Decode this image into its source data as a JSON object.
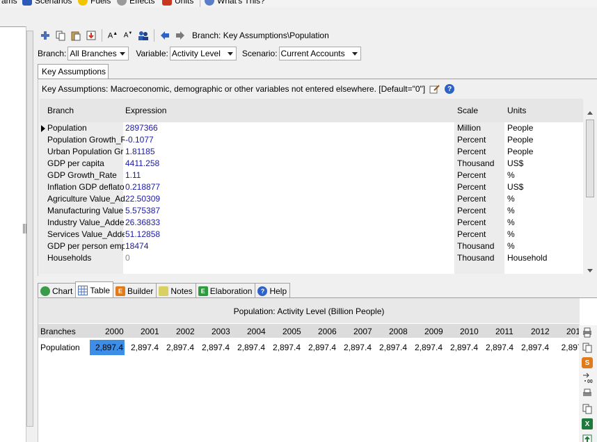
{
  "menu": {
    "items": [
      {
        "label": "rams",
        "icon": "diagrams-icon"
      },
      {
        "label": "Scenarios",
        "icon": "scenarios-icon"
      },
      {
        "label": "Fuels",
        "icon": "fuels-icon"
      },
      {
        "label": "Effects",
        "icon": "effects-icon"
      },
      {
        "label": "Units",
        "icon": "units-icon"
      },
      {
        "label": "What's This?",
        "icon": "whats-this-icon"
      }
    ]
  },
  "toolbar": {
    "path_text": "Branch: Key Assumptions\\Population"
  },
  "filters": {
    "branch_label": "Branch:",
    "branch_value": "All Branches",
    "variable_label": "Variable:",
    "variable_value": "Activity Level",
    "scenario_label": "Scenario:",
    "scenario_value": "Current Accounts"
  },
  "key_assumptions": {
    "tab_label": "Key Assumptions",
    "description": "Key Assumptions: Macroeconomic, demographic or other variables not entered elsewhere. [Default=\"0\"]",
    "columns": {
      "branch": "Branch",
      "expression": "Expression",
      "scale": "Scale",
      "units": "Units"
    },
    "rows": [
      {
        "branch": "Population",
        "expression": "2897366",
        "scale": "Million",
        "units": "People"
      },
      {
        "branch": "Population Growth_R",
        "expression": "-0.1077",
        "scale": "Percent",
        "units": "People"
      },
      {
        "branch": "Urban Population Gr",
        "expression": "1.81185",
        "scale": "Percent",
        "units": "People"
      },
      {
        "branch": "GDP per capita",
        "expression": "4411.258",
        "scale": "Thousand",
        "units": "US$"
      },
      {
        "branch": "GDP Growth_Rate",
        "expression": "1.11",
        "scale": "Percent",
        "units": "%"
      },
      {
        "branch": "Inflation GDP deflato",
        "expression": "0.218877",
        "scale": "Percent",
        "units": "US$"
      },
      {
        "branch": "Agriculture Value_Ad",
        "expression": "22.50309",
        "scale": "Percent",
        "units": "%"
      },
      {
        "branch": "Manufacturing Value",
        "expression": "5.575387",
        "scale": "Percent",
        "units": "%"
      },
      {
        "branch": "Industry Value_Adde",
        "expression": "26.36833",
        "scale": "Percent",
        "units": "%"
      },
      {
        "branch": "Services Value_Adde",
        "expression": "51.12858",
        "scale": "Percent",
        "units": "%"
      },
      {
        "branch": "GDP per person emp",
        "expression": "18474",
        "scale": "Thousand",
        "units": "%"
      },
      {
        "branch": "Households",
        "expression": "0",
        "scale": "Thousand",
        "units": "Household"
      }
    ]
  },
  "bottom_tabs": [
    {
      "label": "Chart",
      "icon": "chart-icon"
    },
    {
      "label": "Table",
      "icon": "table-icon"
    },
    {
      "label": "Builder",
      "icon": "builder-icon"
    },
    {
      "label": "Notes",
      "icon": "notes-icon"
    },
    {
      "label": "Elaboration",
      "icon": "elaboration-icon"
    },
    {
      "label": "Help",
      "icon": "help-icon"
    }
  ],
  "results_table": {
    "title": "Population: Activity Level (Billion People)",
    "first_header": "Branches",
    "years": [
      "2000",
      "2001",
      "2002",
      "2003",
      "2004",
      "2005",
      "2006",
      "2007",
      "2008",
      "2009",
      "2010",
      "2011",
      "2012",
      "201"
    ],
    "row_label": "Population",
    "values": [
      "2,897.4",
      "2,897.4",
      "2,897.4",
      "2,897.4",
      "2,897.4",
      "2,897.4",
      "2,897.4",
      "2,897.4",
      "2,897.4",
      "2,897.4",
      "2,897.4",
      "2,897.4",
      "2,897.4",
      "2,897."
    ]
  },
  "colors": {
    "expression_text": "#1a1aa8",
    "selection": "#3d8ee6",
    "header_bg": "#e6e6e6"
  }
}
